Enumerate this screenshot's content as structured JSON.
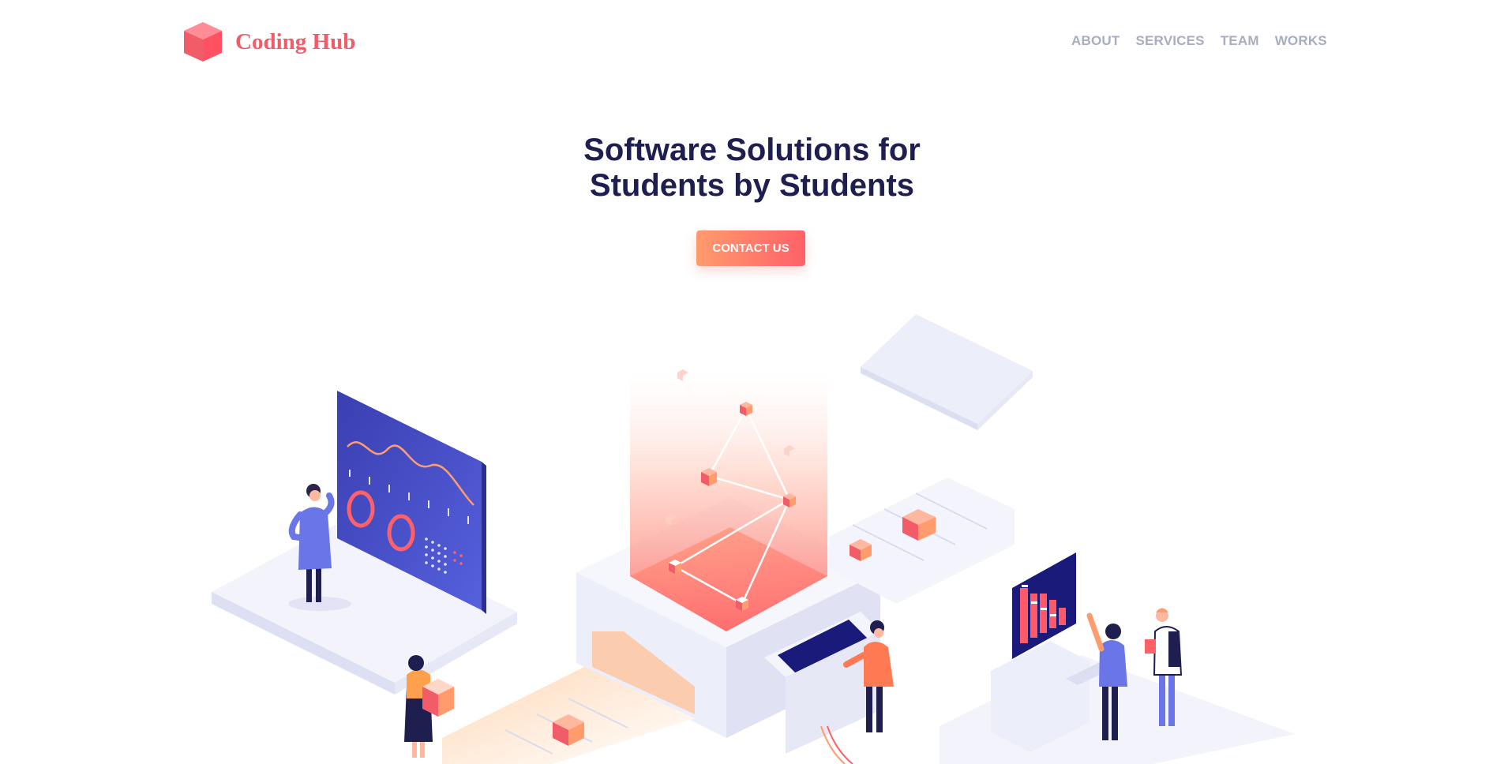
{
  "brand": {
    "name": "Coding Hub",
    "icon": "cube-logo-icon"
  },
  "nav": {
    "items": [
      {
        "label": "ABOUT"
      },
      {
        "label": "SERVICES"
      },
      {
        "label": "TEAM"
      },
      {
        "label": "WORKS"
      }
    ]
  },
  "hero": {
    "title_line1": "Software Solutions for",
    "title_line2": "Students by Students",
    "cta_label": "CONTACT US"
  },
  "colors": {
    "brand": "#f25c69",
    "nav_text": "#a9acc2",
    "heading": "#1e1e4f",
    "cta_start": "#ff9b6d",
    "cta_end": "#ff6168"
  }
}
